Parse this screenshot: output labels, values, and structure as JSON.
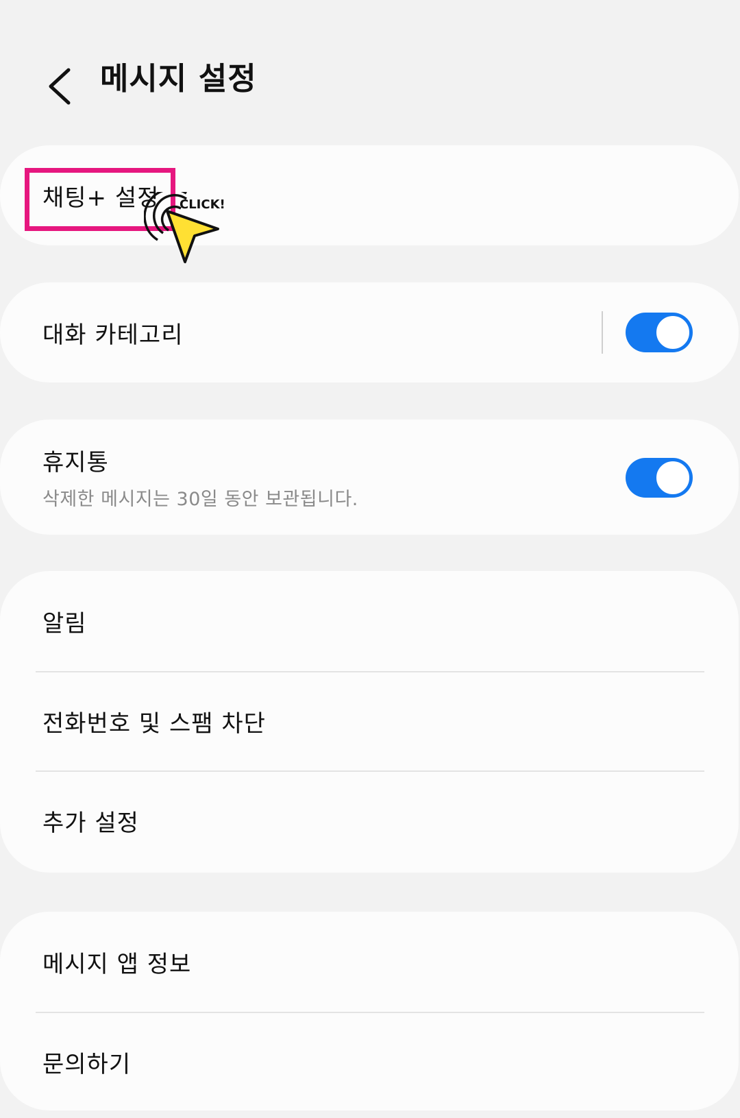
{
  "header": {
    "back_icon": "chevron-left-icon",
    "title": "메시지 설정"
  },
  "chat_plus": {
    "label": "채팅+ 설정"
  },
  "category": {
    "label": "대화 카테고리",
    "toggle_on": true
  },
  "trash": {
    "label": "휴지통",
    "description": "삭제한 메시지는 30일 동안 보관됩니다.",
    "toggle_on": true
  },
  "main_menu": {
    "items": [
      {
        "label": "알림"
      },
      {
        "label": "전화번호 및 스팸 차단"
      },
      {
        "label": "추가 설정"
      }
    ]
  },
  "info_menu": {
    "items": [
      {
        "label": "메시지 앱 정보"
      },
      {
        "label": "문의하기"
      }
    ]
  },
  "annotation": {
    "click_text": "CLICK!",
    "highlight_color": "#e6177f",
    "cursor_color": "#ffe033"
  },
  "colors": {
    "background": "#f2f2f2",
    "card": "#fcfcfc",
    "toggle_accent": "#1479f0"
  }
}
